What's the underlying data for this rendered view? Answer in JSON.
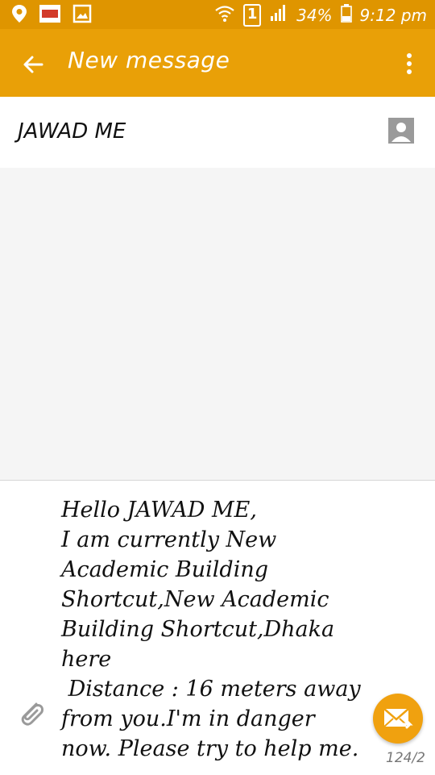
{
  "status_bar": {
    "sim_label": "1",
    "battery": "34%",
    "time": "9:12 pm",
    "icons": [
      "location-icon",
      "app-notification-icon",
      "gallery-icon",
      "wifi-icon",
      "sim-icon",
      "signal-icon",
      "battery-icon"
    ]
  },
  "app_bar": {
    "title": "New message",
    "back_icon": "arrow-left-icon",
    "menu_icon": "more-vert-icon"
  },
  "recipient": {
    "name": "JAWAD ME",
    "contact_icon": "contact-icon"
  },
  "compose": {
    "message": "Hello JAWAD ME,\nI am currently New\nAcademic Building\nShortcut,New Academic\nBuilding Shortcut,Dhaka\nhere\n Distance : 16 meters away\nfrom you.I'm in danger\nnow. Please try to help me.",
    "counter": "124/2",
    "attach_icon": "paperclip-icon",
    "send_icon": "send-mail-icon"
  },
  "colors": {
    "status_bar": "#df9500",
    "app_bar": "#e9a007",
    "send_button": "#f0a10f"
  }
}
